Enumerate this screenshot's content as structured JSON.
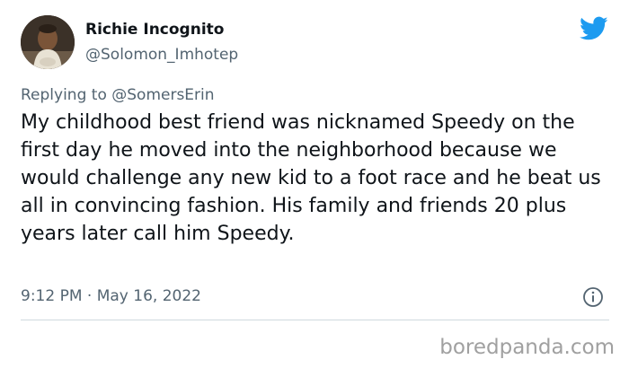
{
  "author": {
    "display_name": "Richie Incognito",
    "handle": "@Solomon_Imhotep",
    "avatar": "baby-photo-avatar"
  },
  "reply": {
    "prefix": "Replying to",
    "mention": "@SomersErin"
  },
  "tweet": {
    "text": "My childhood best friend was nicknamed Speedy on the first day he moved into the neighborhood because we would challenge any new kid to a foot race and he beat us all in convincing fashion. His family and friends 20 plus years later call him Speedy.",
    "timestamp": "9:12 PM · May 16, 2022"
  },
  "icons": {
    "brand": "twitter-bird-icon",
    "info": "info-icon"
  },
  "colors": {
    "twitter_blue": "#1d9bf0",
    "secondary_text": "#536471",
    "primary_text": "#0f1419",
    "watermark": "#a0a0a0"
  },
  "watermark": {
    "text": "boredpanda.com"
  }
}
